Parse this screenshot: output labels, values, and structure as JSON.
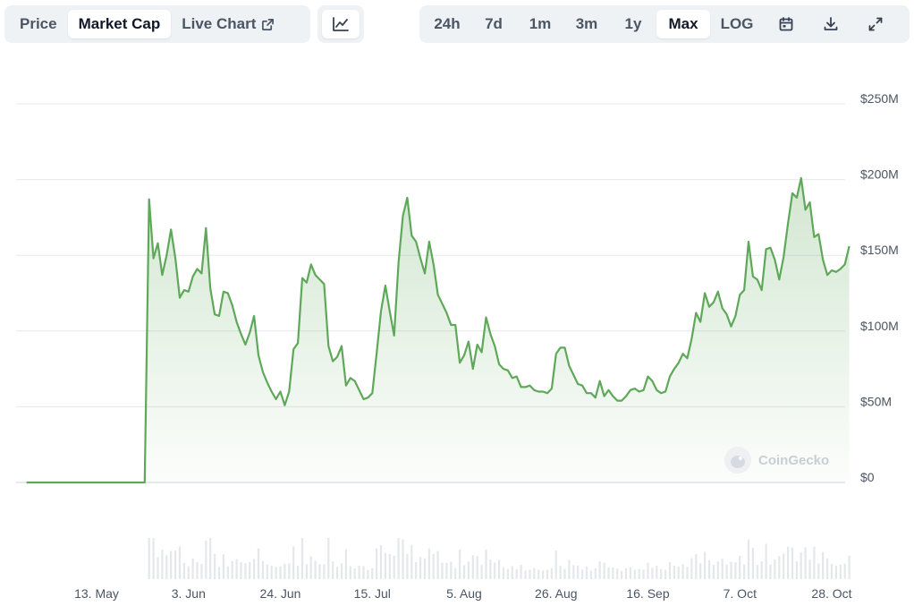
{
  "toolbar": {
    "tabs": [
      {
        "label": "Price",
        "active": false
      },
      {
        "label": "Market Cap",
        "active": true
      },
      {
        "label": "Live Chart",
        "active": false
      }
    ],
    "chart_toggle_icon": "line-chart-icon",
    "ranges": [
      {
        "label": "24h",
        "active": false
      },
      {
        "label": "7d",
        "active": false
      },
      {
        "label": "1m",
        "active": false
      },
      {
        "label": "3m",
        "active": false
      },
      {
        "label": "1y",
        "active": false
      },
      {
        "label": "Max",
        "active": true
      },
      {
        "label": "LOG",
        "active": false
      }
    ],
    "icons": [
      "calendar-icon",
      "download-icon",
      "expand-icon"
    ]
  },
  "watermark": "CoinGecko",
  "colors": {
    "line": "#5fa85a",
    "fill": "#d9efd6",
    "volume": "#e5e7eb",
    "grid": "#e5e7eb"
  },
  "chart_data": {
    "type": "area",
    "title": "",
    "xlabel": "",
    "ylabel": "",
    "y_ticks": [
      "$0",
      "$50M",
      "$100M",
      "$150M",
      "$200M",
      "$250M"
    ],
    "ylim": [
      0,
      250000000
    ],
    "x_ticks": [
      {
        "label": "13. May",
        "date": "2024-05-13"
      },
      {
        "label": "3. Jun",
        "date": "2024-06-03"
      },
      {
        "label": "24. Jun",
        "date": "2024-06-24"
      },
      {
        "label": "15. Jul",
        "date": "2024-07-15"
      },
      {
        "label": "5. Aug",
        "date": "2024-08-05"
      },
      {
        "label": "26. Aug",
        "date": "2024-08-26"
      },
      {
        "label": "16. Sep",
        "date": "2024-09-16"
      },
      {
        "label": "7. Oct",
        "date": "2024-10-07"
      },
      {
        "label": "28. Oct",
        "date": "2024-10-28"
      }
    ],
    "series": [
      {
        "points": [
          [
            "2024-04-27",
            0
          ],
          [
            "2024-05-24",
            0
          ],
          [
            "2024-05-25",
            187
          ],
          [
            "2024-05-26",
            148
          ],
          [
            "2024-05-27",
            158
          ],
          [
            "2024-05-28",
            137
          ],
          [
            "2024-05-29",
            150
          ],
          [
            "2024-05-30",
            167
          ],
          [
            "2024-05-31",
            148
          ],
          [
            "2024-06-01",
            122
          ],
          [
            "2024-06-02",
            127
          ],
          [
            "2024-06-03",
            126
          ],
          [
            "2024-06-04",
            136
          ],
          [
            "2024-06-05",
            141
          ],
          [
            "2024-06-06",
            138
          ],
          [
            "2024-06-07",
            168
          ],
          [
            "2024-06-08",
            128
          ],
          [
            "2024-06-09",
            111
          ],
          [
            "2024-06-10",
            110
          ],
          [
            "2024-06-11",
            126
          ],
          [
            "2024-06-12",
            125
          ],
          [
            "2024-06-13",
            117
          ],
          [
            "2024-06-14",
            106
          ],
          [
            "2024-06-15",
            98
          ],
          [
            "2024-06-16",
            91
          ],
          [
            "2024-06-17",
            99
          ],
          [
            "2024-06-18",
            110
          ],
          [
            "2024-06-19",
            84
          ],
          [
            "2024-06-20",
            73
          ],
          [
            "2024-06-21",
            66
          ],
          [
            "2024-06-22",
            60
          ],
          [
            "2024-06-23",
            55
          ],
          [
            "2024-06-24",
            60
          ],
          [
            "2024-06-25",
            51
          ],
          [
            "2024-06-26",
            60
          ],
          [
            "2024-06-27",
            88
          ],
          [
            "2024-06-28",
            92
          ],
          [
            "2024-06-29",
            135
          ],
          [
            "2024-06-30",
            132
          ],
          [
            "2024-07-01",
            144
          ],
          [
            "2024-07-02",
            137
          ],
          [
            "2024-07-03",
            134
          ],
          [
            "2024-07-04",
            131
          ],
          [
            "2024-07-05",
            90
          ],
          [
            "2024-07-06",
            80
          ],
          [
            "2024-07-07",
            83
          ],
          [
            "2024-07-08",
            90
          ],
          [
            "2024-07-09",
            64
          ],
          [
            "2024-07-10",
            69
          ],
          [
            "2024-07-11",
            67
          ],
          [
            "2024-07-12",
            61
          ],
          [
            "2024-07-13",
            55
          ],
          [
            "2024-07-14",
            56
          ],
          [
            "2024-07-15",
            59
          ],
          [
            "2024-07-16",
            85
          ],
          [
            "2024-07-17",
            113
          ],
          [
            "2024-07-18",
            130
          ],
          [
            "2024-07-19",
            113
          ],
          [
            "2024-07-20",
            97
          ],
          [
            "2024-07-21",
            145
          ],
          [
            "2024-07-22",
            176
          ],
          [
            "2024-07-23",
            188
          ],
          [
            "2024-07-24",
            163
          ],
          [
            "2024-07-25",
            159
          ],
          [
            "2024-07-26",
            148
          ],
          [
            "2024-07-27",
            138
          ],
          [
            "2024-07-28",
            159
          ],
          [
            "2024-07-29",
            144
          ],
          [
            "2024-07-30",
            124
          ],
          [
            "2024-07-31",
            118
          ],
          [
            "2024-08-01",
            112
          ],
          [
            "2024-08-02",
            104
          ],
          [
            "2024-08-03",
            104
          ],
          [
            "2024-08-04",
            79
          ],
          [
            "2024-08-05",
            84
          ],
          [
            "2024-08-06",
            93
          ],
          [
            "2024-08-07",
            75
          ],
          [
            "2024-08-08",
            91
          ],
          [
            "2024-08-09",
            86
          ],
          [
            "2024-08-10",
            109
          ],
          [
            "2024-08-11",
            98
          ],
          [
            "2024-08-12",
            90
          ],
          [
            "2024-08-13",
            78
          ],
          [
            "2024-08-14",
            75
          ],
          [
            "2024-08-15",
            74
          ],
          [
            "2024-08-16",
            69
          ],
          [
            "2024-08-17",
            70
          ],
          [
            "2024-08-18",
            63
          ],
          [
            "2024-08-19",
            63
          ],
          [
            "2024-08-20",
            64
          ],
          [
            "2024-08-21",
            61
          ],
          [
            "2024-08-22",
            60
          ],
          [
            "2024-08-23",
            60
          ],
          [
            "2024-08-24",
            59
          ],
          [
            "2024-08-25",
            62
          ],
          [
            "2024-08-26",
            85
          ],
          [
            "2024-08-27",
            89
          ],
          [
            "2024-08-28",
            89
          ],
          [
            "2024-08-29",
            77
          ],
          [
            "2024-08-30",
            71
          ],
          [
            "2024-08-31",
            65
          ],
          [
            "2024-09-01",
            64
          ],
          [
            "2024-09-02",
            59
          ],
          [
            "2024-09-03",
            59
          ],
          [
            "2024-09-04",
            56
          ],
          [
            "2024-09-05",
            67
          ],
          [
            "2024-09-06",
            57
          ],
          [
            "2024-09-07",
            61
          ],
          [
            "2024-09-08",
            57
          ],
          [
            "2024-09-09",
            54
          ],
          [
            "2024-09-10",
            54
          ],
          [
            "2024-09-11",
            57
          ],
          [
            "2024-09-12",
            61
          ],
          [
            "2024-09-13",
            62
          ],
          [
            "2024-09-14",
            60
          ],
          [
            "2024-09-15",
            61
          ],
          [
            "2024-09-16",
            70
          ],
          [
            "2024-09-17",
            67
          ],
          [
            "2024-09-18",
            61
          ],
          [
            "2024-09-19",
            59
          ],
          [
            "2024-09-20",
            60
          ],
          [
            "2024-09-21",
            70
          ],
          [
            "2024-09-22",
            75
          ],
          [
            "2024-09-23",
            79
          ],
          [
            "2024-09-24",
            85
          ],
          [
            "2024-09-25",
            82
          ],
          [
            "2024-09-26",
            95
          ],
          [
            "2024-09-27",
            112
          ],
          [
            "2024-09-28",
            106
          ],
          [
            "2024-09-29",
            125
          ],
          [
            "2024-09-30",
            116
          ],
          [
            "2024-10-01",
            119
          ],
          [
            "2024-10-02",
            126
          ],
          [
            "2024-10-03",
            115
          ],
          [
            "2024-10-04",
            111
          ],
          [
            "2024-10-05",
            103
          ],
          [
            "2024-10-06",
            110
          ],
          [
            "2024-10-07",
            124
          ],
          [
            "2024-10-08",
            127
          ],
          [
            "2024-10-09",
            159
          ],
          [
            "2024-10-10",
            136
          ],
          [
            "2024-10-11",
            134
          ],
          [
            "2024-10-12",
            127
          ],
          [
            "2024-10-13",
            154
          ],
          [
            "2024-10-14",
            155
          ],
          [
            "2024-10-15",
            147
          ],
          [
            "2024-10-16",
            134
          ],
          [
            "2024-10-17",
            149
          ],
          [
            "2024-10-18",
            171
          ],
          [
            "2024-10-19",
            191
          ],
          [
            "2024-10-20",
            188
          ],
          [
            "2024-10-21",
            201
          ],
          [
            "2024-10-22",
            180
          ],
          [
            "2024-10-23",
            185
          ],
          [
            "2024-10-24",
            162
          ],
          [
            "2024-10-25",
            164
          ],
          [
            "2024-10-26",
            147
          ],
          [
            "2024-10-27",
            137
          ],
          [
            "2024-10-28",
            140
          ],
          [
            "2024-10-29",
            139
          ],
          [
            "2024-10-30",
            141
          ],
          [
            "2024-10-31",
            144
          ],
          [
            "2024-11-01",
            156
          ]
        ]
      }
    ],
    "legend": "none",
    "grid": true
  }
}
